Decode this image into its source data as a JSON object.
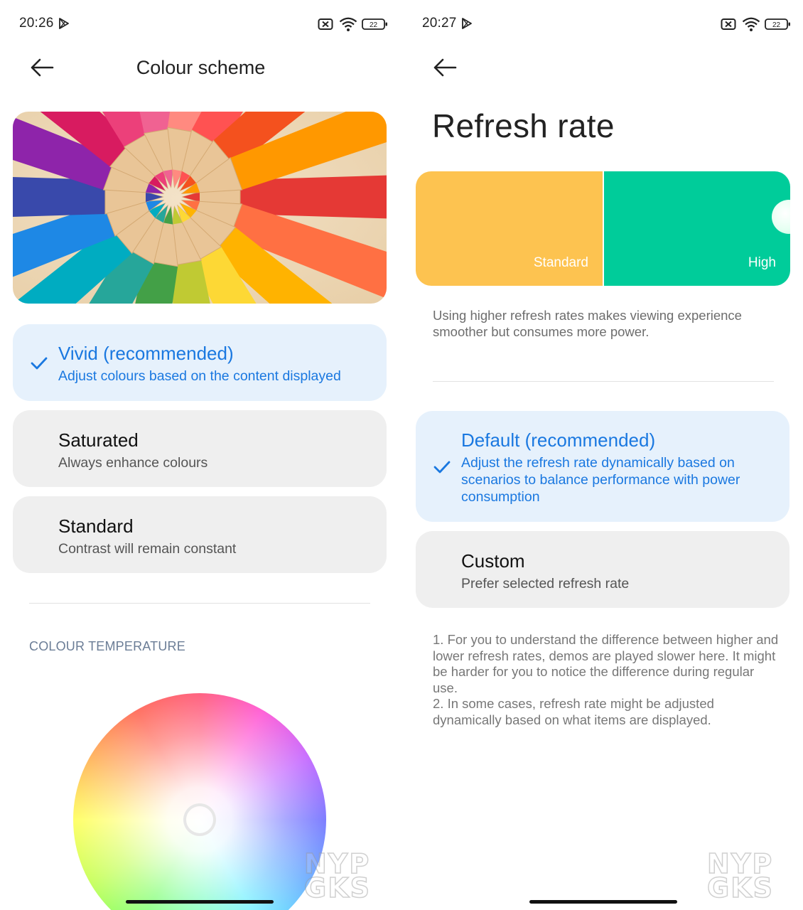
{
  "left_screen": {
    "status": {
      "time": "20:26",
      "battery": "22"
    },
    "page_title": "Colour scheme",
    "options": [
      {
        "title": "Vivid (recommended)",
        "subtitle": "Adjust colours based on the content displayed",
        "selected": true
      },
      {
        "title": "Saturated",
        "subtitle": "Always enhance colours",
        "selected": false
      },
      {
        "title": "Standard",
        "subtitle": "Contrast will remain constant",
        "selected": false
      }
    ],
    "section_label": "COLOUR TEMPERATURE"
  },
  "right_screen": {
    "status": {
      "time": "20:27",
      "battery": "22"
    },
    "page_title": "Refresh rate",
    "preview": {
      "standard_label": "Standard",
      "high_label": "High"
    },
    "description": "Using higher refresh rates makes viewing experience smoother but consumes more power.",
    "options": [
      {
        "title": "Default (recommended)",
        "subtitle": "Adjust the refresh rate dynamically based on scenarios to balance performance with power consumption",
        "selected": true
      },
      {
        "title": "Custom",
        "subtitle": "Prefer selected refresh rate",
        "selected": false
      }
    ],
    "notes": "1. For you to understand the difference between higher and lower refresh rates, demos are played slower here. It might be harder for you to notice the difference during regular use.\n2. In some cases, refresh rate might be adjusted dynamically based on what items are displayed."
  },
  "watermark": {
    "line1": "NYP",
    "line2": "GKS"
  },
  "colors": {
    "accent": "#1a78e0",
    "selected_card": "#e6f1fc",
    "card": "#efefef",
    "standard_rate": "#fdc350",
    "high_rate": "#00cc9a"
  },
  "icons": [
    "play-store-icon",
    "battery-saver-icon",
    "wifi-icon",
    "battery-icon",
    "back-arrow-icon",
    "check-icon"
  ]
}
